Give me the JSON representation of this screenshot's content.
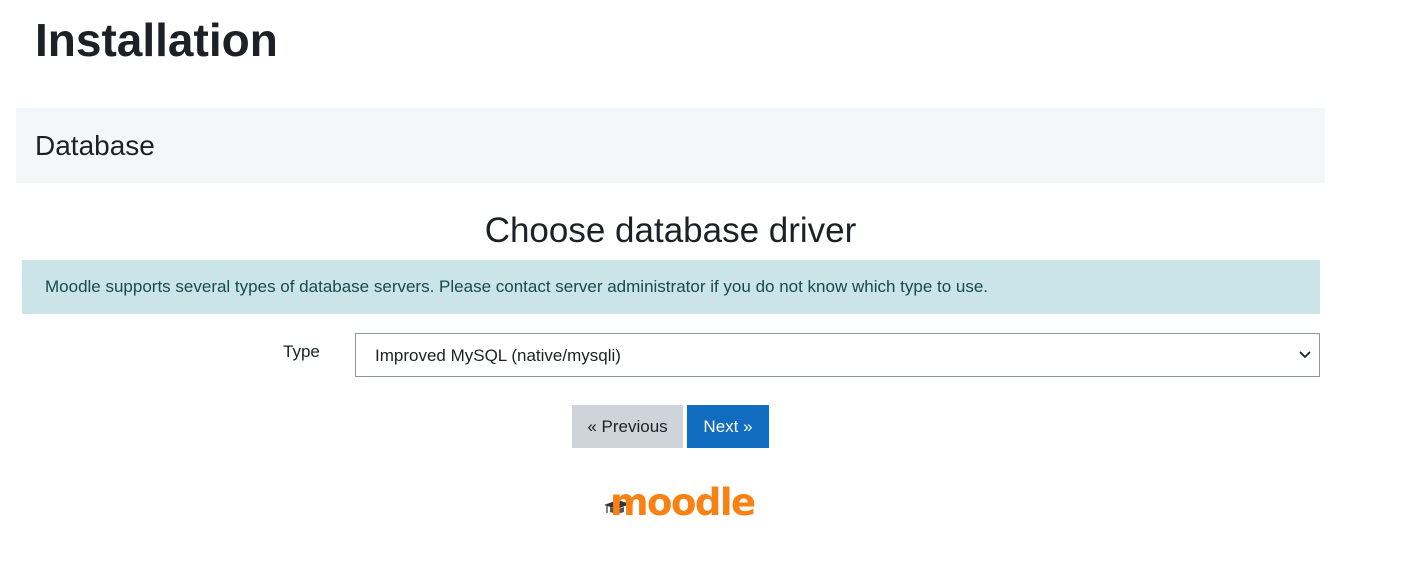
{
  "page": {
    "title": "Installation"
  },
  "stage": {
    "heading": "Database"
  },
  "section": {
    "heading": "Choose database driver"
  },
  "alert": {
    "text": "Moodle supports several types of database servers. Please contact server administrator if you do not know which type to use."
  },
  "form": {
    "type_label": "Type",
    "type_selected": "Improved MySQL (native/mysqli)"
  },
  "buttons": {
    "previous_label": "« Previous",
    "next_label": "Next »"
  },
  "logo": {
    "text": "moodle"
  },
  "colors": {
    "primary": "#0f6cbf",
    "alert_bg": "#cae4e7",
    "secondary_button": "#ced4da",
    "logo_orange": "#f98012"
  },
  "icons": {
    "select_chevron": "chevron-down-icon",
    "logo_cap": "graduation-cap-icon"
  }
}
